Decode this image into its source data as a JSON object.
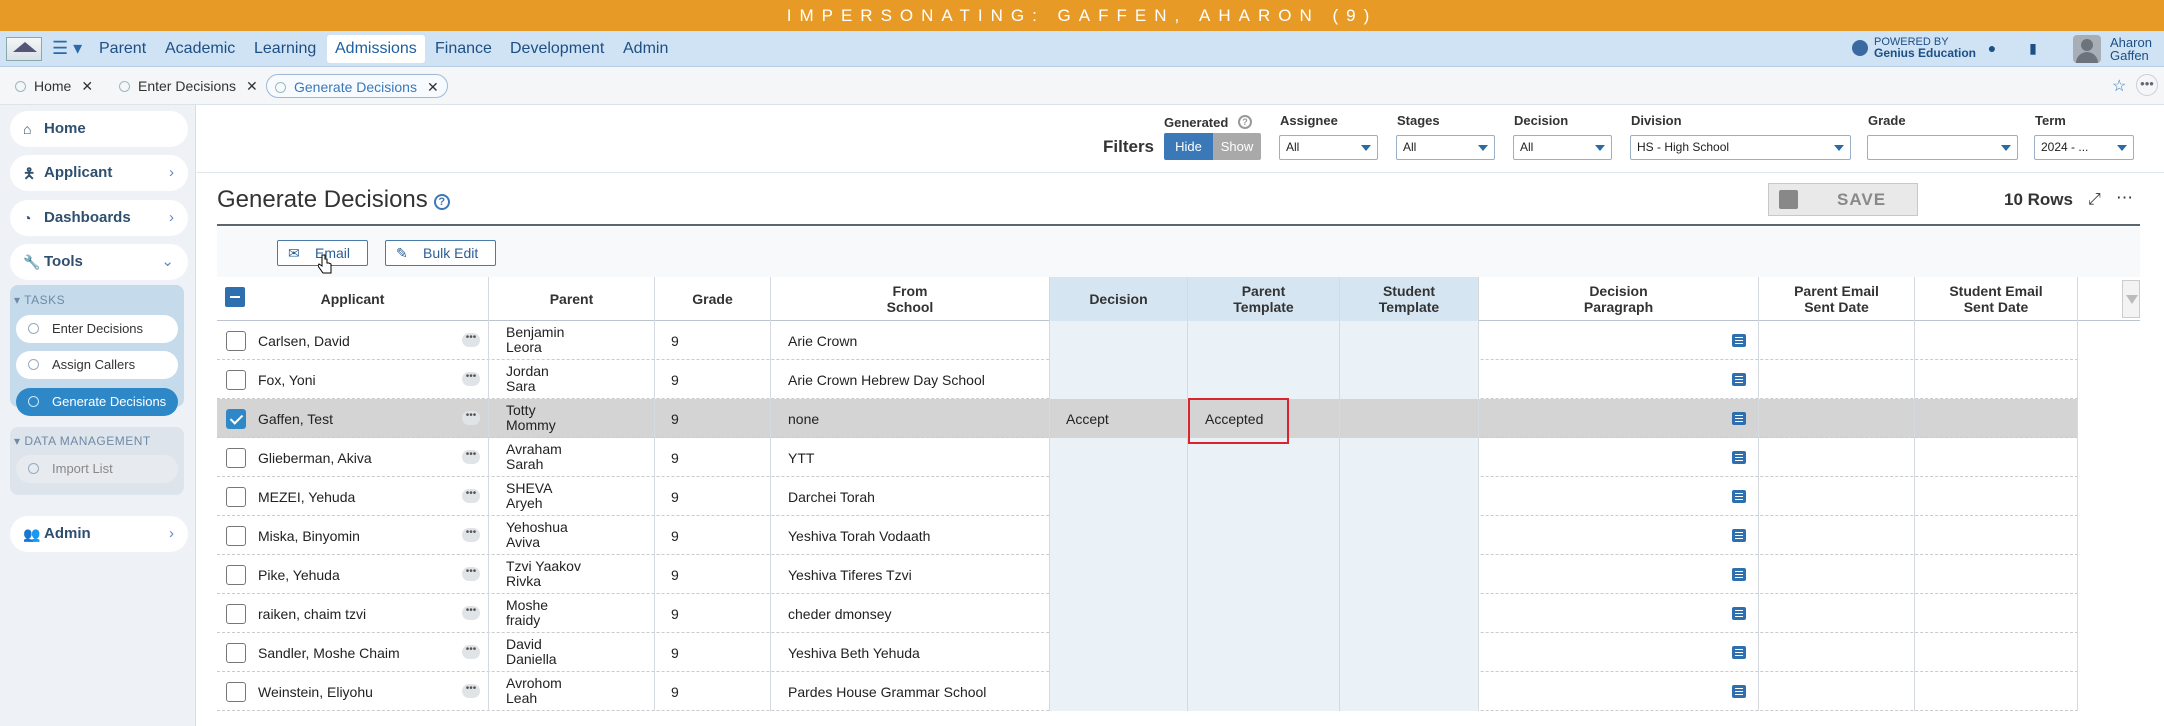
{
  "banner": "IMPERSONATING: GAFFEN, AHARON (9)",
  "nav": {
    "items": [
      "Parent",
      "Academic",
      "Learning",
      "Admissions",
      "Finance",
      "Development",
      "Admin"
    ],
    "active": "Admissions",
    "powered_by_line1": "POWERED BY",
    "powered_by_line2": "Genius Education",
    "user_first": "Aharon",
    "user_last": "Gaffen"
  },
  "tabs": [
    "Home",
    "Enter Decisions",
    "Generate Decisions"
  ],
  "sidebar": {
    "home": "Home",
    "applicant": "Applicant",
    "dashboards": "Dashboards",
    "tools": "Tools",
    "tasks_header": "TASKS",
    "tasks": [
      "Enter Decisions",
      "Assign Callers",
      "Generate Decisions"
    ],
    "data_header": "DATA MANAGEMENT",
    "data_items": [
      "Import List"
    ],
    "admin": "Admin"
  },
  "filters": {
    "label": "Filters",
    "generated_label": "Generated",
    "hide": "Hide",
    "show": "Show",
    "assignee_label": "Assignee",
    "assignee_value": "All",
    "stages_label": "Stages",
    "stages_value": "All",
    "decision_label": "Decision",
    "decision_value": "All",
    "division_label": "Division",
    "division_value": "HS - High School",
    "grade_label": "Grade",
    "grade_value": "",
    "term_label": "Term",
    "term_value": "2024 - ..."
  },
  "page": {
    "title": "Generate Decisions",
    "save": "SAVE",
    "rows_count": "10 Rows",
    "email": "Email",
    "bulk_edit": "Bulk Edit"
  },
  "columns": {
    "applicant": "Applicant",
    "parent": "Parent",
    "grade": "Grade",
    "from_school_1": "From",
    "from_school_2": "School",
    "decision": "Decision",
    "parent_template_1": "Parent",
    "parent_template_2": "Template",
    "student_template_1": "Student",
    "student_template_2": "Template",
    "decision_paragraph_1": "Decision",
    "decision_paragraph_2": "Paragraph",
    "parent_email_1": "Parent Email",
    "parent_email_2": "Sent Date",
    "student_email_1": "Student Email",
    "student_email_2": "Sent Date"
  },
  "rows": [
    {
      "applicant": "Carlsen, David",
      "parent1": "Benjamin",
      "parent2": "Leora",
      "grade": "9",
      "school": "Arie Crown",
      "decision": "",
      "parent_template": "",
      "checked": false
    },
    {
      "applicant": "Fox, Yoni",
      "parent1": "Jordan",
      "parent2": "Sara",
      "grade": "9",
      "school": "Arie Crown Hebrew Day School",
      "decision": "",
      "parent_template": "",
      "checked": false
    },
    {
      "applicant": "Gaffen, Test",
      "parent1": "Totty",
      "parent2": "Mommy",
      "grade": "9",
      "school": "none",
      "decision": "Accept",
      "parent_template": "Accepted",
      "checked": true
    },
    {
      "applicant": "Glieberman, Akiva",
      "parent1": "Avraham",
      "parent2": "Sarah",
      "grade": "9",
      "school": "YTT",
      "decision": "",
      "parent_template": "",
      "checked": false
    },
    {
      "applicant": "MEZEI, Yehuda",
      "parent1": "SHEVA",
      "parent2": "Aryeh",
      "grade": "9",
      "school": "Darchei Torah",
      "decision": "",
      "parent_template": "",
      "checked": false
    },
    {
      "applicant": "Miska, Binyomin",
      "parent1": "Yehoshua",
      "parent2": "Aviva",
      "grade": "9",
      "school": "Yeshiva Torah Vodaath",
      "decision": "",
      "parent_template": "",
      "checked": false
    },
    {
      "applicant": "Pike, Yehuda",
      "parent1": "Tzvi Yaakov",
      "parent2": "Rivka",
      "grade": "9",
      "school": "Yeshiva Tiferes Tzvi",
      "decision": "",
      "parent_template": "",
      "checked": false
    },
    {
      "applicant": "raiken, chaim tzvi",
      "parent1": "Moshe",
      "parent2": "fraidy",
      "grade": "9",
      "school": "cheder dmonsey",
      "decision": "",
      "parent_template": "",
      "checked": false
    },
    {
      "applicant": "Sandler, Moshe Chaim",
      "parent1": "David",
      "parent2": "Daniella",
      "grade": "9",
      "school": "Yeshiva Beth Yehuda",
      "decision": "",
      "parent_template": "",
      "checked": false
    },
    {
      "applicant": "Weinstein, Eliyohu",
      "parent1": "Avrohom",
      "parent2": "Leah",
      "grade": "9",
      "school": "Pardes House Grammar School",
      "decision": "",
      "parent_template": "",
      "checked": false
    }
  ]
}
